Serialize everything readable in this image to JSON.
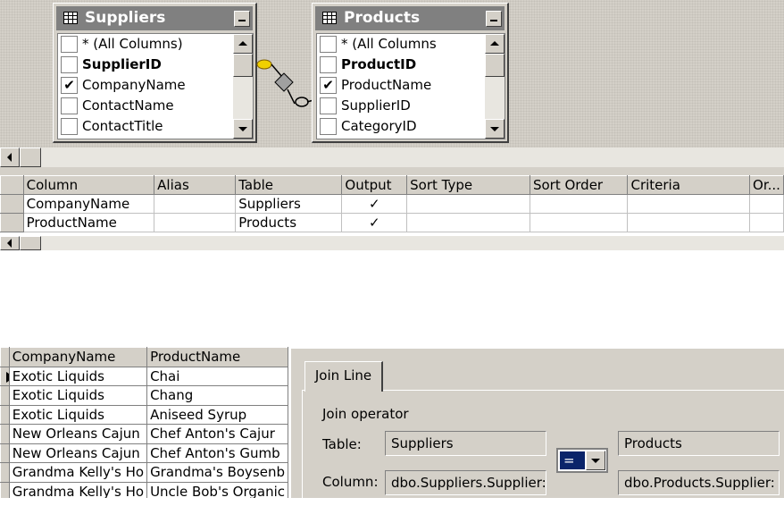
{
  "diagram": {
    "tables": [
      {
        "title": "Suppliers",
        "columns": [
          {
            "label": "* (All Columns)",
            "checked": false,
            "bold": false
          },
          {
            "label": "SupplierID",
            "checked": false,
            "bold": true
          },
          {
            "label": "CompanyName",
            "checked": true,
            "bold": false
          },
          {
            "label": "ContactName",
            "checked": false,
            "bold": false
          },
          {
            "label": "ContactTitle",
            "checked": false,
            "bold": false
          }
        ]
      },
      {
        "title": "Products",
        "columns": [
          {
            "label": "* (All Columns",
            "checked": false,
            "bold": false
          },
          {
            "label": "ProductID",
            "checked": false,
            "bold": true
          },
          {
            "label": "ProductName",
            "checked": true,
            "bold": false
          },
          {
            "label": "SupplierID",
            "checked": false,
            "bold": false
          },
          {
            "label": "CategoryID",
            "checked": false,
            "bold": false
          }
        ]
      }
    ]
  },
  "grid": {
    "headers": [
      "Column",
      "Alias",
      "Table",
      "Output",
      "Sort Type",
      "Sort Order",
      "Criteria",
      "Or..."
    ],
    "rows": [
      {
        "column": "CompanyName",
        "alias": "",
        "table": "Suppliers",
        "output": "✓",
        "sort_type": "",
        "sort_order": "",
        "criteria": "",
        "or": ""
      },
      {
        "column": "ProductName",
        "alias": "",
        "table": "Products",
        "output": "✓",
        "sort_type": "",
        "sort_order": "",
        "criteria": "",
        "or": ""
      }
    ]
  },
  "results": {
    "headers": [
      "CompanyName",
      "ProductName"
    ],
    "rows": [
      [
        "Exotic Liquids",
        "Chai"
      ],
      [
        "Exotic Liquids",
        "Chang"
      ],
      [
        "Exotic Liquids",
        "Aniseed Syrup"
      ],
      [
        "New Orleans Cajun",
        "Chef Anton's Cajur"
      ],
      [
        "New Orleans Cajun",
        "Chef Anton's Gumb"
      ],
      [
        "Grandma Kelly's Ho",
        "Grandma's Boysenb"
      ],
      [
        "Grandma Kelly's Ho",
        "Uncle Bob's Organic"
      ]
    ]
  },
  "join": {
    "tab_label": "Join Line",
    "operator_label": "Join operator",
    "table_label": "Table:",
    "column_label": "Column:",
    "left_table": "Suppliers",
    "right_table": "Products",
    "operator": "=",
    "left_column": "dbo.Suppliers.Supplier:",
    "right_column": "dbo.Products.Supplier:"
  }
}
